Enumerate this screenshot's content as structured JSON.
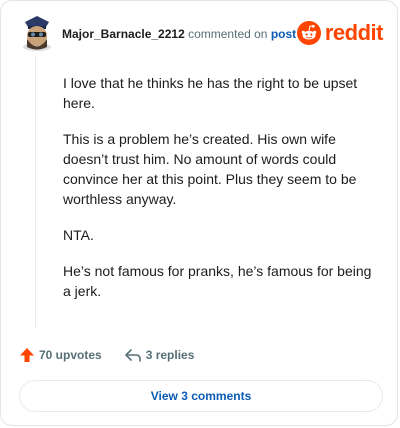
{
  "comment": {
    "author": "Major_Barnacle_2212",
    "action_text": "commented on",
    "post_link_text": "post",
    "paragraphs": [
      "I love that he thinks he has the right to be upset here.",
      "This is a problem he’s created. His own wife doesn’t trust him. No amount of words could convince her at this point. Plus they seem to be worthless anyway.",
      "NTA.",
      "He’s not famous for pranks, he’s famous for being a jerk."
    ]
  },
  "brand": {
    "wordmark": "reddit",
    "accent_color": "#ff4500"
  },
  "footer": {
    "upvotes_label": "70 upvotes",
    "replies_label": "3 replies",
    "view_comments_label": "View 3 comments"
  },
  "icons": {
    "avatar": "avatar-icon",
    "logo": "reddit-logo-icon",
    "upvote": "upvote-arrow-icon",
    "reply": "reply-arrow-icon"
  }
}
